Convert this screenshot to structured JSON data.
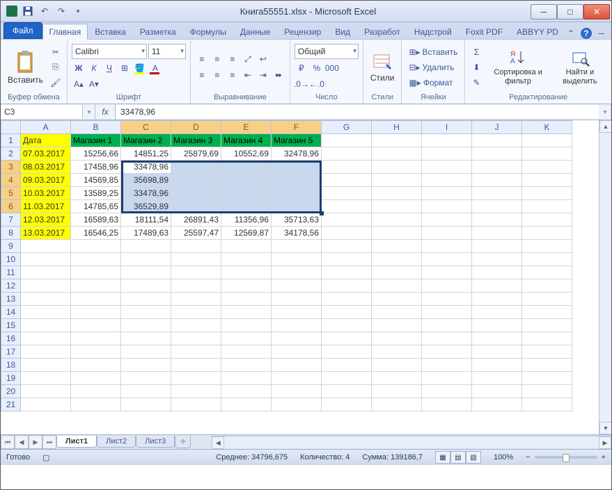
{
  "title": "Книга55551.xlsx - Microsoft Excel",
  "tabs": {
    "file": "Файл",
    "home": "Главная",
    "insert": "Вставка",
    "layout": "Разметка",
    "formulas": "Формулы",
    "data": "Данные",
    "review": "Рецензир",
    "view": "Вид",
    "dev": "Разработ",
    "addins": "Надстрой",
    "foxit": "Foxit PDF",
    "abbyy": "ABBYY PD"
  },
  "groups": {
    "clipboard": "Буфер обмена",
    "font": "Шрифт",
    "align": "Выравнивание",
    "number": "Число",
    "styles": "Стили",
    "cells": "Ячейки",
    "editing": "Редактирование"
  },
  "btns": {
    "paste": "Вставить",
    "styles": "Стили",
    "insert": "Вставить",
    "delete": "Удалить",
    "format": "Формат",
    "sort": "Сортировка и фильтр",
    "find": "Найти и выделить"
  },
  "font": {
    "name": "Calibri",
    "size": "11"
  },
  "numfmt": "Общий",
  "namebox": "C3",
  "formula": "33478,96",
  "columns": [
    "A",
    "B",
    "C",
    "D",
    "E",
    "F",
    "G",
    "H",
    "I",
    "J",
    "K"
  ],
  "rownums": [
    "1",
    "2",
    "3",
    "4",
    "5",
    "6",
    "7",
    "8",
    "9",
    "10",
    "11",
    "12",
    "13",
    "14",
    "15",
    "16",
    "17",
    "18",
    "19",
    "20",
    "21"
  ],
  "headers": {
    "A": "Дата",
    "B": "Магазин 1",
    "C": "Магазин 2",
    "D": "Магазин 3",
    "E": "Магазин 4",
    "F": "Магазин 5"
  },
  "data": [
    {
      "A": "07.03.2017",
      "B": "15256,66",
      "C": "14851,25",
      "D": "25879,69",
      "E": "10552,69",
      "F": "32478,96"
    },
    {
      "A": "08.03.2017",
      "B": "17458,96",
      "C": "33478,96",
      "D": "",
      "E": "",
      "F": ""
    },
    {
      "A": "09.03.2017",
      "B": "14569,85",
      "C": "35698,89",
      "D": "",
      "E": "",
      "F": ""
    },
    {
      "A": "10.03.2017",
      "B": "13589,25",
      "C": "33478,96",
      "D": "",
      "E": "",
      "F": ""
    },
    {
      "A": "11.03.2017",
      "B": "14785,65",
      "C": "36529,89",
      "D": "",
      "E": "",
      "F": ""
    },
    {
      "A": "12.03.2017",
      "B": "16589,63",
      "C": "18111,54",
      "D": "26891,43",
      "E": "11356,96",
      "F": "35713,63"
    },
    {
      "A": "13.03.2017",
      "B": "16546,25",
      "C": "17489,63",
      "D": "25597,47",
      "E": "12569,87",
      "F": "34178,56"
    }
  ],
  "sheets": [
    "Лист1",
    "Лист2",
    "Лист3"
  ],
  "status": {
    "ready": "Готово",
    "avg": "Среднее: 34796,675",
    "count": "Количество: 4",
    "sum": "Сумма: 139186,7",
    "zoom": "100%"
  }
}
